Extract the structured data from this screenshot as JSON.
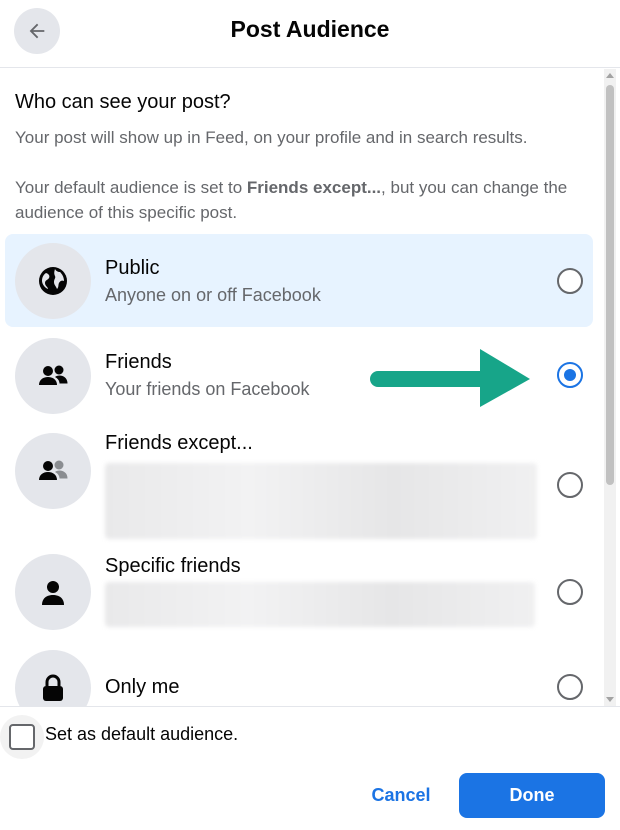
{
  "header": {
    "title": "Post Audience",
    "back_icon": "arrow-left-icon"
  },
  "intro": {
    "question": "Who can see your post?",
    "description": "Your post will show up in Feed, on your profile and in search results.",
    "default_prefix": "Your default audience is set to ",
    "default_value": "Friends except...",
    "default_suffix": ", but you can change the audience of this specific post."
  },
  "options": [
    {
      "title": "Public",
      "subtitle": "Anyone on or off Facebook",
      "icon": "globe-icon",
      "selected": false,
      "highlighted": true
    },
    {
      "title": "Friends",
      "subtitle": "Your friends on Facebook",
      "icon": "friends-icon",
      "selected": true,
      "highlighted": false
    },
    {
      "title": "Friends except...",
      "subtitle": "",
      "icon": "friends-except-icon",
      "selected": false,
      "highlighted": false
    },
    {
      "title": "Specific friends",
      "subtitle": "",
      "icon": "person-icon",
      "selected": false,
      "highlighted": false
    },
    {
      "title": "Only me",
      "subtitle": "",
      "icon": "lock-icon",
      "selected": false,
      "highlighted": false
    }
  ],
  "footer": {
    "checkbox_label": "Set as default audience.",
    "cancel_label": "Cancel",
    "done_label": "Done"
  },
  "colors": {
    "accent": "#1b74e4",
    "highlight_bg": "#e7f3ff",
    "annotation_arrow": "#17a589"
  }
}
